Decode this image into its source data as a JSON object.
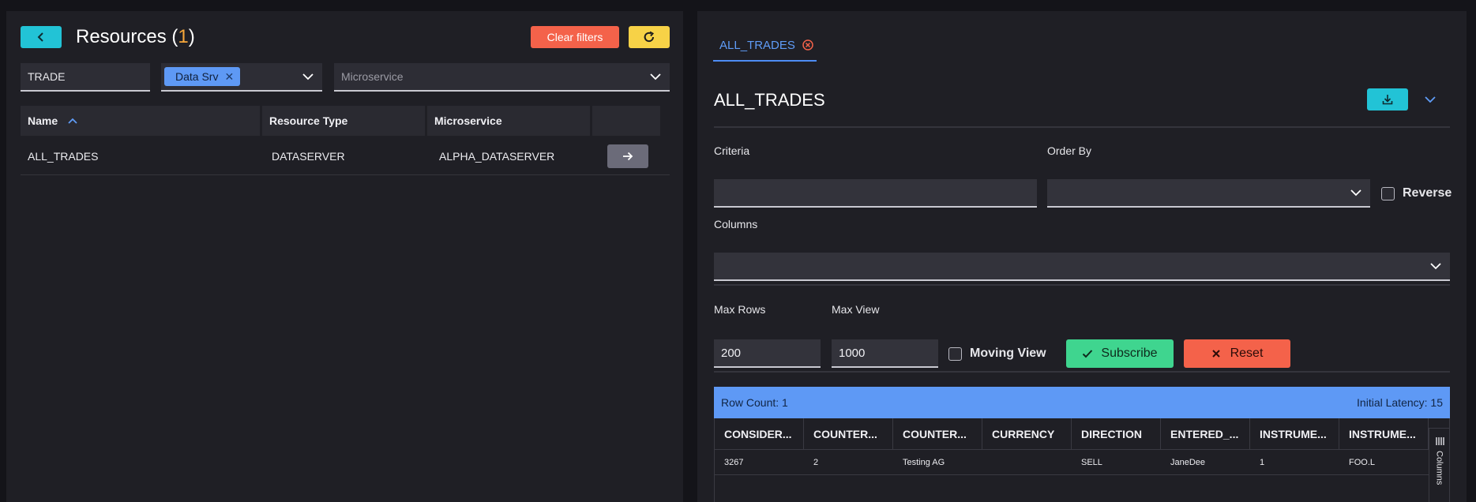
{
  "left": {
    "title": "Resources (",
    "count": "1",
    "title_end": ")",
    "clear_filters": "Clear filters",
    "filters": {
      "name_value": "TRADE",
      "type_chip": "Data Srv",
      "microservice_placeholder": "Microservice"
    },
    "columns": [
      "Name",
      "Resource Type",
      "Microservice"
    ],
    "rows": [
      {
        "name": "ALL_TRADES",
        "type": "DATASERVER",
        "microservice": "ALPHA_DATASERVER"
      }
    ]
  },
  "right": {
    "tab_label": "ALL_TRADES",
    "resource_title": "ALL_TRADES",
    "criteria_label": "Criteria",
    "criteria_value": "",
    "order_by_label": "Order By",
    "reverse_label": "Reverse",
    "columns_label": "Columns",
    "max_rows_label": "Max Rows",
    "max_rows_value": "200",
    "max_view_label": "Max View",
    "max_view_value": "1000",
    "moving_view_label": "Moving View",
    "subscribe_label": "Subscribe",
    "reset_label": "Reset",
    "row_count": "Row Count: 1",
    "latency": "Initial Latency: 15",
    "grid_headers": [
      "CONSIDER...",
      "COUNTER...",
      "COUNTER...",
      "CURRENCY",
      "DIRECTION",
      "ENTERED_...",
      "INSTRUME...",
      "INSTRUME..."
    ],
    "grid_row": [
      "3267",
      "2",
      "Testing AG",
      "",
      "SELL",
      "JaneDee",
      "1",
      "FOO.L"
    ],
    "side_tool_label": "Columns"
  },
  "colors": {
    "teal": "#22c3d6",
    "red": "#f4624a",
    "yellow": "#f7d247",
    "blue": "#5e99f5",
    "green": "#3fd58f",
    "orange_count": "#f7a73a"
  },
  "icons": [
    "chevron-left-icon",
    "refresh-icon",
    "close-icon",
    "chevron-down-icon",
    "sort-asc-icon",
    "arrow-right-icon",
    "close-circle-icon",
    "download-icon",
    "check-icon",
    "columns-icon"
  ]
}
